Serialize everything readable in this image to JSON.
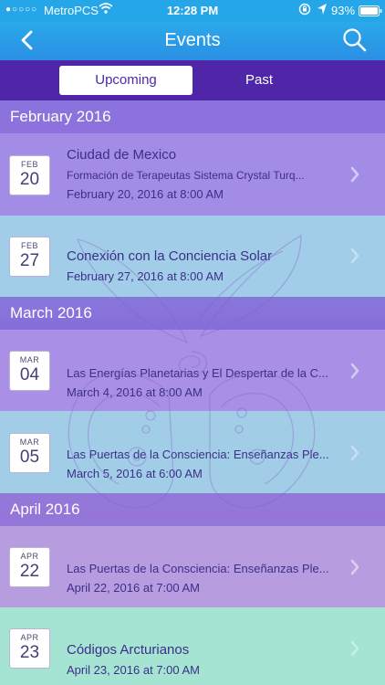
{
  "status": {
    "carrier": "MetroPCS",
    "time": "12:28 PM",
    "battery": "93%"
  },
  "nav": {
    "title": "Events",
    "back_icon": "chevron-left-icon",
    "search_icon": "search-icon"
  },
  "tabs": {
    "upcoming": "Upcoming",
    "past": "Past"
  },
  "sections": [
    {
      "label": "February 2016",
      "events": [
        {
          "month": "FEB",
          "day": "20",
          "title": "Ciudad de Mexico",
          "subtitle": "Formación de Terapeutas Sistema Crystal Turq...",
          "datetime": "February 20, 2016 at 8:00 AM"
        },
        {
          "month": "FEB",
          "day": "27",
          "title": "Conexión con la Conciencia Solar",
          "datetime": "February 27, 2016 at 8:00 AM"
        }
      ]
    },
    {
      "label": "March 2016",
      "events": [
        {
          "month": "MAR",
          "day": "04",
          "title": "Las Energías Planetarias y El Despertar de la C...",
          "datetime": "March 4, 2016 at 8:00 AM"
        },
        {
          "month": "MAR",
          "day": "05",
          "title": "Las Puertas de la Consciencia: Enseñanzas Ple...",
          "datetime": "March 5, 2016 at 6:00 AM"
        }
      ]
    },
    {
      "label": "April 2016",
      "events": [
        {
          "month": "APR",
          "day": "22",
          "title": "Las Puertas de la Consciencia: Enseñanzas Ple...",
          "datetime": "April 22, 2016 at 7:00 AM"
        },
        {
          "month": "APR",
          "day": "23",
          "title": "Códigos Arcturianos",
          "datetime": "April 23, 2016 at 7:00 AM"
        }
      ]
    }
  ],
  "colors": {
    "statusbar": "#24a6e8",
    "navbar": "#2b8fe4",
    "segment_bar": "#4e26a7",
    "text": "#3c2f88"
  }
}
